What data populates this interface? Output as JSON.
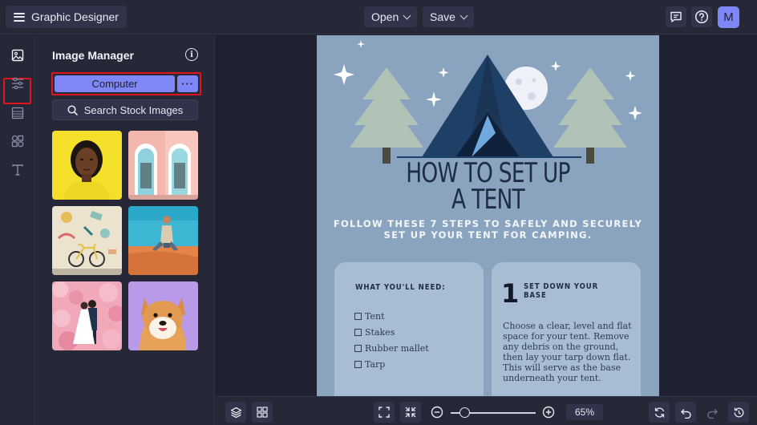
{
  "header": {
    "app_title": "Graphic Designer",
    "open_label": "Open",
    "save_label": "Save",
    "avatar_initial": "M",
    "icons": [
      "menu-icon",
      "comment-icon",
      "help-icon"
    ]
  },
  "rail": {
    "items": [
      "image-icon",
      "sliders-icon",
      "layout-icon",
      "shapes-icon",
      "text-icon"
    ],
    "active": "image-icon"
  },
  "panel": {
    "title": "Image Manager",
    "computer_label": "Computer",
    "more_label": "···",
    "search_label": "Search Stock Images",
    "thumbnails": [
      "woman-portrait",
      "pink-doors",
      "bicycle-wall",
      "man-on-sand",
      "wedding-couple",
      "shiba-dog"
    ]
  },
  "design": {
    "headline_line1": "HOW TO SET UP",
    "headline_line2": "A TENT",
    "subtitle_line1": "FOLLOW THESE 7 STEPS TO SAFELY AND SECURELY",
    "subtitle_line2": "SET UP YOUR TENT FOR CAMPING.",
    "needs_title": "WHAT YOU'LL NEED:",
    "needs": [
      "Tent",
      "Stakes",
      "Rubber mallet",
      "Tarp"
    ],
    "step_number": "1",
    "step_title": "SET DOWN YOUR BASE",
    "step_text": "Choose a clear, level and flat space for your tent. Remove any debris on the ground, then lay your tarp down flat. This will serve as the base underneath your tent."
  },
  "footer": {
    "zoom": "65%",
    "zoom_level_percent": 65
  },
  "colors": {
    "accent": "#7f86f5",
    "highlight": "#e0151c",
    "page_bg": "#8aa3bf"
  }
}
